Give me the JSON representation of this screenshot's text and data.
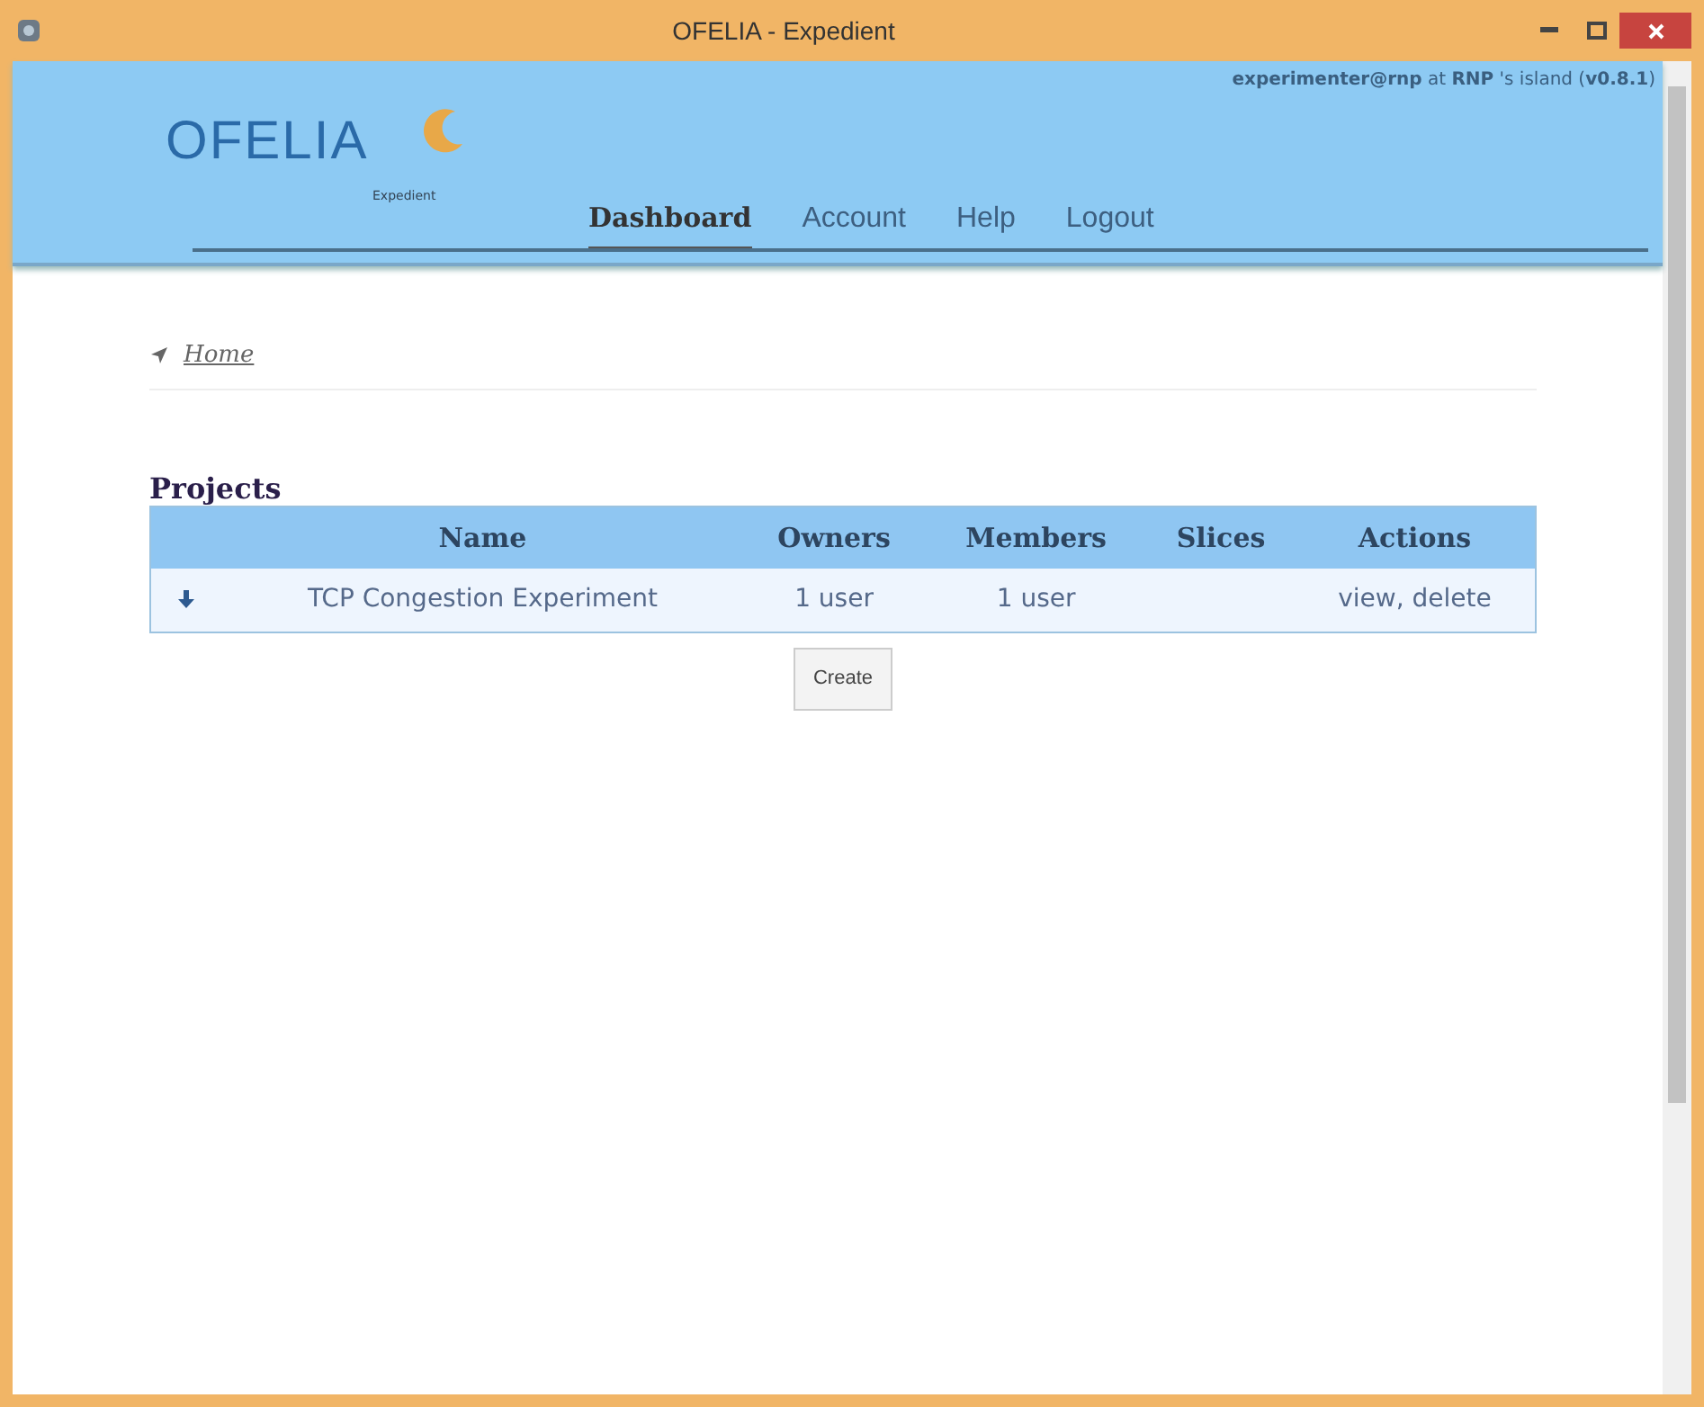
{
  "window": {
    "title": "OFELIA - Expedient"
  },
  "header": {
    "user_line": "**experimenter@rnp** at **RNP** 's island (**v0.8.1**)",
    "logo": "OFELIA",
    "logo_sub": "Expedient"
  },
  "nav": [
    {
      "label": "Dashboard",
      "selected": true
    },
    {
      "label": "Account",
      "selected": false
    },
    {
      "label": "Help",
      "selected": false
    },
    {
      "label": "Logout",
      "selected": false
    }
  ],
  "breadcrumb": "Home",
  "projects": {
    "title": "Projects",
    "columns": [
      "Name",
      "Owners",
      "Members",
      "Slices",
      "Actions"
    ],
    "rows": [
      {
        "name": "TCP Congestion Experiment",
        "owners": "1 user",
        "members": "1 user",
        "actions": [
          "view",
          "delete"
        ],
        "action_separator": ","
      }
    ],
    "create_button": "Create"
  }
}
